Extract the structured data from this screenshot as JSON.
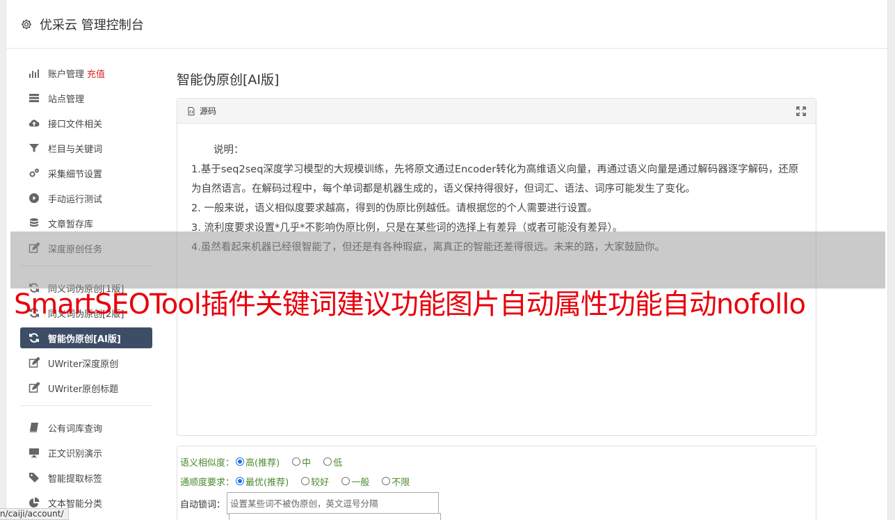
{
  "header": {
    "title": "优采云 管理控制台"
  },
  "sidebar": {
    "account_label": "账户管理",
    "recharge_label": "充值",
    "group1": [
      "站点管理",
      "接口文件相关",
      "栏目与关键词",
      "采集细节设置",
      "手动运行测试",
      "文章暂存库",
      "深度原创任务"
    ],
    "group2": [
      "同义词伪原创[1版]",
      "同义词伪原创[2版]",
      "智能伪原创[AI版]",
      "UWriter深度原创",
      "UWriter原创标题"
    ],
    "group3": [
      "公有词库查询",
      "正文识别演示",
      "智能提取标签",
      "文本智能分类"
    ]
  },
  "main": {
    "title": "智能伪原创[AI版]",
    "source_button": "源码",
    "content": {
      "heading": "说明：",
      "p1": "1.基于seq2seq深度学习模型的大规模训练，先将原文通过Encoder转化为高维语义向量，再通过语义向量是通过解码器逐字解码，还原为自然语言。在解码过程中，每个单词都是机器生成的，语义保持得很好，但词汇、语法、词序可能发生了变化。",
      "p2": "2. 一般来说，语义相似度要求越高，得到的伪原比例越低。请根据您的个人需要进行设置。",
      "p3": "3. 流利度要求设置*几乎*不影响伪原比例，只是在某些词的选择上有差异（或者可能没有差异）。",
      "p4": "4.虽然看起来机器已经很智能了，但还是有各种瑕疵，离真正的智能还差得很远。未来的路，大家鼓励你。"
    },
    "options": {
      "similarity_label": "语义相似度：",
      "similarity": [
        "高(推荐)",
        "中",
        "低"
      ],
      "fluency_label": "通顺度要求：",
      "fluency": [
        "最优(推荐)",
        "较好",
        "一般",
        "不限"
      ],
      "lock_label": "自动锁词：",
      "lock_placeholder": "设置某些词不被伪原创，英文逗号分隔"
    }
  },
  "overlay": {
    "text": "SmartSEOTool插件关键词建议功能图片自动属性功能自动nofollo"
  },
  "statusbar": {
    "url": "n/caiji/account/"
  }
}
